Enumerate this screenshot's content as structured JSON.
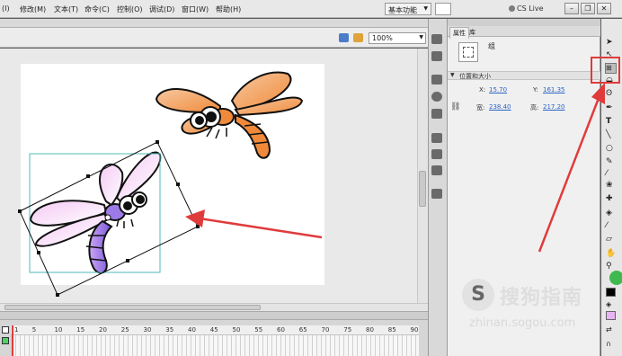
{
  "menu": [
    "(I)",
    "修改(M)",
    "文本(T)",
    "命令(C)",
    "控制(O)",
    "调试(D)",
    "窗口(W)",
    "帮助(H)"
  ],
  "window": {
    "workspace": "基本功能",
    "cs_live": "CS Live",
    "minimize": "–",
    "restore": "❐",
    "close": "✕"
  },
  "editbar": {
    "zoom": "100%"
  },
  "panel": {
    "tabs": [
      "属性",
      "库"
    ],
    "symbol_type": "组",
    "section_title": "位置和大小",
    "position": {
      "x_label": "X:",
      "x_value": "15.70",
      "y_label": "Y:",
      "y_value": "161.35"
    },
    "size": {
      "w_label": "宽:",
      "w_value": "238.40",
      "h_label": "高:",
      "h_value": "217.20"
    }
  },
  "timeline": {
    "frames": [
      "1",
      "5",
      "10",
      "15",
      "20",
      "25",
      "30",
      "35",
      "40",
      "45",
      "50",
      "55",
      "60",
      "65",
      "70",
      "75",
      "80",
      "85",
      "90"
    ]
  },
  "tools": [
    "selection-tool",
    "subselection-tool",
    "free-transform-tool",
    "gradient-transform-tool",
    "lasso-tool",
    "pen-tool",
    "text-tool",
    "line-tool",
    "rectangle-tool",
    "pencil-tool",
    "brush-tool",
    "deco-tool",
    "bone-tool",
    "paint-bucket-tool",
    "eyedropper-tool",
    "eraser-tool",
    "hand-tool",
    "zoom-tool"
  ],
  "colors": {
    "stroke": "#000000",
    "fill": "#e8b4f4",
    "highlight": "#e03b3b",
    "selection_box": "#4fb8b8"
  },
  "watermark": {
    "logo": "S",
    "name": "搜狗指南",
    "url": "zhinan.sogou.com"
  }
}
